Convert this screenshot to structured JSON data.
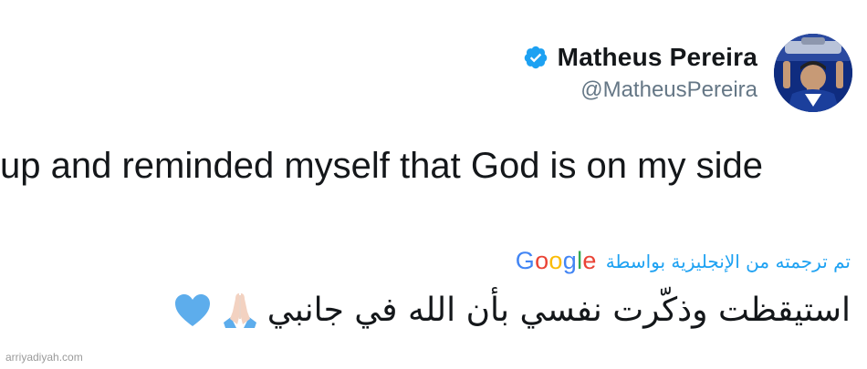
{
  "user": {
    "display_name": "Matheus Pereira",
    "handle": "@MatheusPereira",
    "verified": true,
    "avatar_icon": "profile-photo"
  },
  "tweet": {
    "text": "up and reminded myself that God is on my side"
  },
  "translation": {
    "label": "تم ترجمته من الإنجليزية بواسطة",
    "provider": "Google",
    "provider_letters": [
      "G",
      "o",
      "o",
      "g",
      "l",
      "e"
    ],
    "text": "استيقظت وذكّرت نفسي بأن الله في جانبي",
    "emojis": [
      "folded-hands-icon",
      "blue-heart-icon"
    ]
  },
  "watermark": "arriyadiyah.com",
  "colors": {
    "link_blue": "#1da1f2",
    "verified_blue": "#1da1f2",
    "handle_gray": "#657786",
    "text": "#14171a",
    "google": [
      "#4285F4",
      "#EA4335",
      "#FBBC05",
      "#4285F4",
      "#34A853",
      "#EA4335"
    ]
  }
}
